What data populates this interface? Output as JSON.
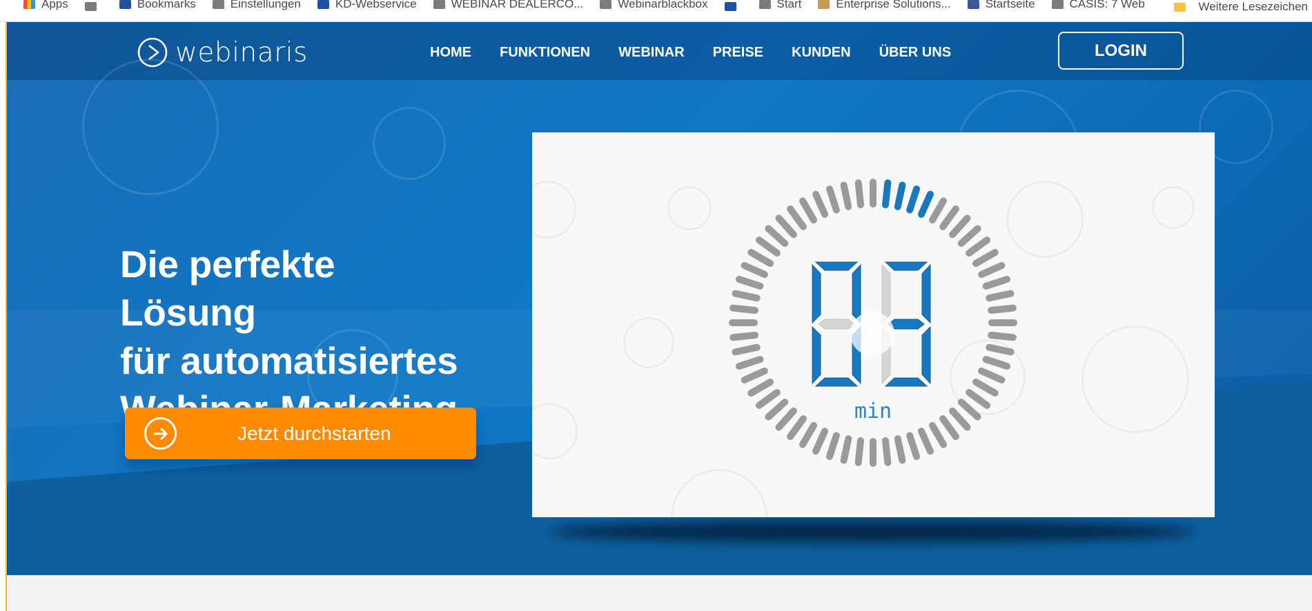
{
  "browser": {
    "bookmarks": [
      {
        "label": "Apps",
        "icon": "apps-icon"
      },
      {
        "label": "",
        "icon": "bookmark-icon"
      },
      {
        "label": "Bookmarks",
        "icon": "star-icon"
      },
      {
        "label": "Einstellungen",
        "icon": "settings-icon"
      },
      {
        "label": "KD-Webservice",
        "icon": "globe-icon"
      },
      {
        "label": "WEBINAR DEALERCO...",
        "icon": "page-icon"
      },
      {
        "label": "Webinarblackbox",
        "icon": "page-icon"
      },
      {
        "label": "",
        "icon": "pin-icon"
      },
      {
        "label": "Start",
        "icon": "page-icon"
      },
      {
        "label": "Enterprise Solutions...",
        "icon": "folder-icon"
      },
      {
        "label": "Startseite",
        "icon": "facebook-icon"
      },
      {
        "label": "CASIS: 7 Web",
        "icon": "page-icon"
      }
    ],
    "right_label": "Weitere Lesezeichen"
  },
  "site": {
    "brand": "webinaris",
    "nav": [
      "HOME",
      "FUNKTIONEN",
      "WEBINAR",
      "PREISE",
      "KUNDEN",
      "ÜBER UNS"
    ],
    "login": "LOGIN",
    "headline_lines": [
      "Die perfekte Lösung",
      "für automatisiertes",
      "Webinar-Marketing"
    ],
    "cta": "Jetzt durchstarten"
  },
  "video": {
    "countdown": "03",
    "countdown_caption": "min",
    "play_icon": "play-icon"
  },
  "colors": {
    "primary_blue": "#0f78c7",
    "dark_blue": "#0a5aa0",
    "orange": "#ff8a00",
    "white": "#ffffff",
    "video_background": "#f8f8f7",
    "countdown_blue": "#1a78bf",
    "countdown_grey": "#9a9a9a"
  }
}
